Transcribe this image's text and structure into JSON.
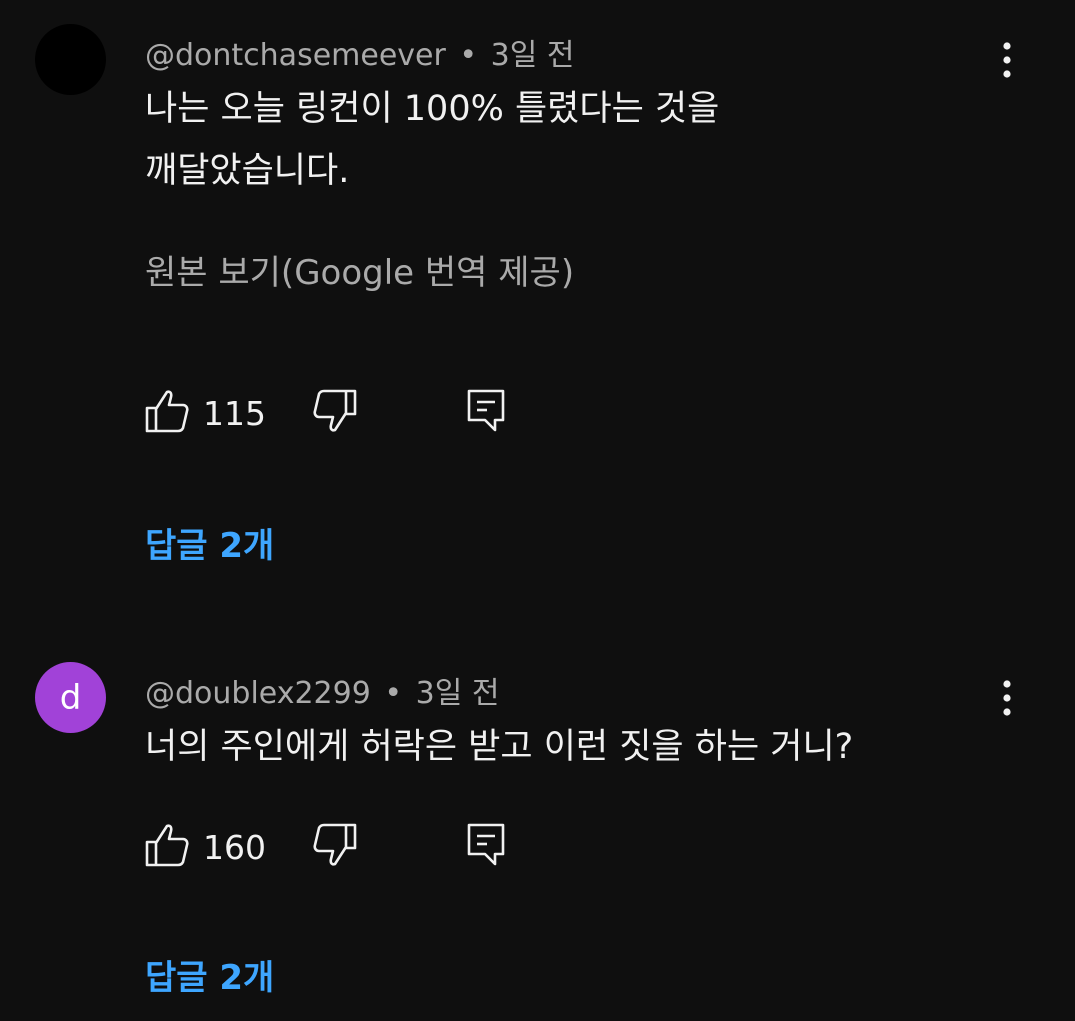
{
  "comments": [
    {
      "avatar_letter": "",
      "avatar_color": "#000000",
      "author": "@dontchasemeever",
      "separator": "•",
      "time": "3일 전",
      "text_lines": [
        "나는 오늘 링컨이 100% 틀렸다는 것을",
        "깨달았습니다."
      ],
      "translate_label": "원본 보기(Google 번역 제공)",
      "likes": "115",
      "replies_label": "답글 2개"
    },
    {
      "avatar_letter": "d",
      "avatar_color": "#a142d8",
      "author": "@doublex2299",
      "separator": "•",
      "time": "3일 전",
      "text_lines": [
        "너의 주인에게 허락은 받고 이런 짓을 하는 거니?"
      ],
      "likes": "160",
      "replies_label": "답글 2개"
    }
  ],
  "icons": {
    "like": "thumb-up-icon",
    "dislike": "thumb-down-icon",
    "reply": "reply-comment-icon",
    "more": "more-vert-icon"
  },
  "colors": {
    "background": "#0f0f0f",
    "text": "#f1f1f1",
    "secondary": "#aaaaaa",
    "link": "#3ea6ff"
  }
}
